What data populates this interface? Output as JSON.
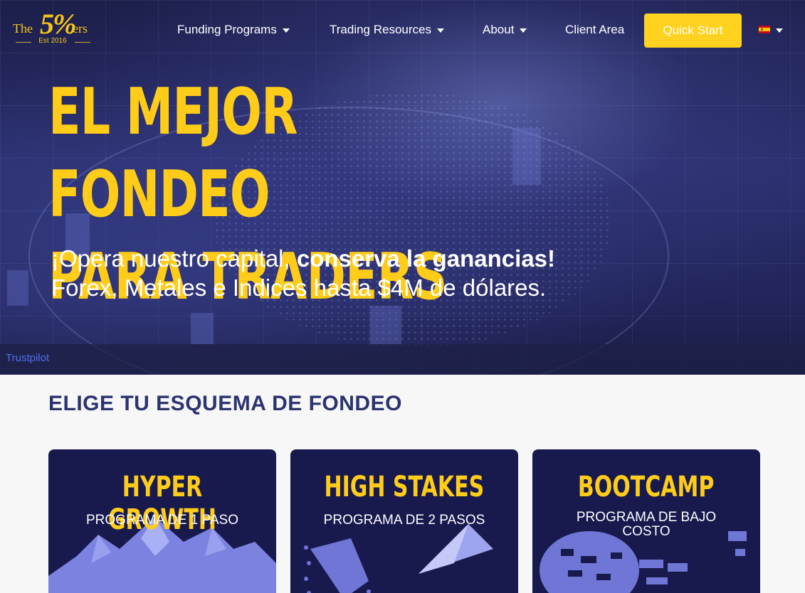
{
  "brand": {
    "logo_the": "The",
    "logo_five": "5%",
    "logo_ers": "ers",
    "logo_est": "Est 2016"
  },
  "nav": {
    "items": [
      {
        "label": "Funding Programs",
        "has_dropdown": true
      },
      {
        "label": "Trading Resources",
        "has_dropdown": true
      },
      {
        "label": "About",
        "has_dropdown": true
      },
      {
        "label": "Client Area",
        "has_dropdown": false
      }
    ],
    "cta_label": "Quick Start",
    "language_flag": "spain-flag-icon"
  },
  "hero": {
    "headline_line1": "EL MEJOR FONDEO",
    "headline_line2": "PARA TRADERS",
    "sub_line1_regular": "¡Opera nuestro capital, ",
    "sub_line1_bold": "conserva la ganancias!",
    "sub_line2": "Forex, Metales e Indices hasta $4M de dólares.",
    "trustpilot": "Trustpilot"
  },
  "programs": {
    "section_title": "ELIGE TU ESQUEMA DE FONDEO",
    "cards": [
      {
        "title": "HYPER GROWTH",
        "subtitle": "PROGRAMA DE 1 PASO",
        "icon": "mountain-icon"
      },
      {
        "title": "HIGH STAKES",
        "subtitle": "PROGRAMA DE 2 PASOS",
        "icon": "paper-plane-icon"
      },
      {
        "title": "BOOTCAMP",
        "subtitle": "PROGRAMA DE BAJO COSTO",
        "icon": "boot-print-icon"
      }
    ]
  },
  "colors": {
    "accent_yellow": "#ffcc1a",
    "button_yellow": "#ffd21f",
    "card_navy": "#181a4e",
    "section_title": "#2b3470",
    "trustpilot_blue": "#4f6ff0"
  }
}
